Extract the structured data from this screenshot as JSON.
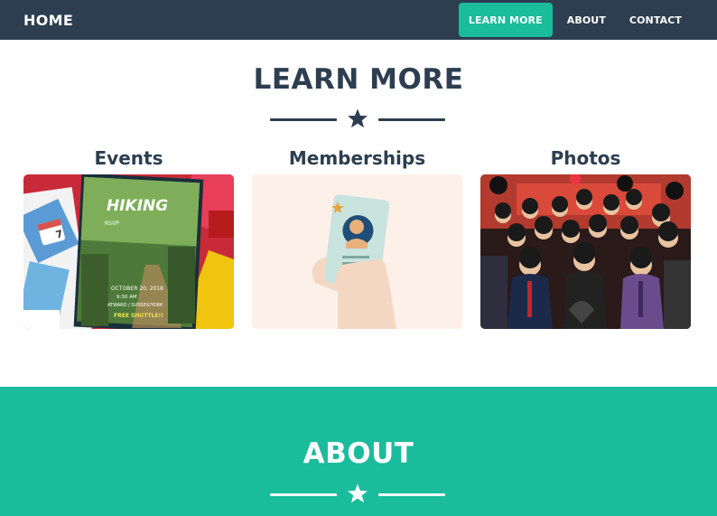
{
  "navbar": {
    "brand": "HOME",
    "links": [
      {
        "label": "LEARN MORE",
        "active": true
      },
      {
        "label": "ABOUT",
        "active": false
      },
      {
        "label": "CONTACT",
        "active": false
      }
    ]
  },
  "learn_more": {
    "title": "LEARN MORE",
    "cards": [
      {
        "label": "Events",
        "image": "events-flyers-collage"
      },
      {
        "label": "Memberships",
        "image": "hand-holding-membership-card"
      },
      {
        "label": "Photos",
        "image": "group-photo"
      }
    ]
  },
  "events_flyer": {
    "title": "HIKING",
    "rsvp": "RSVP",
    "date": "OCTOBER 20, 2018",
    "time": "9:30 AM",
    "place": "ATWARD / SUSSEX/YORK",
    "note": "FREE SHUTTLE!!"
  },
  "about": {
    "title": "ABOUT"
  },
  "colors": {
    "navbar": "#2c3e50",
    "accent": "#1abc9c",
    "heading": "#2c3e50",
    "white": "#ffffff"
  },
  "icons": {
    "divider": "star-icon"
  }
}
